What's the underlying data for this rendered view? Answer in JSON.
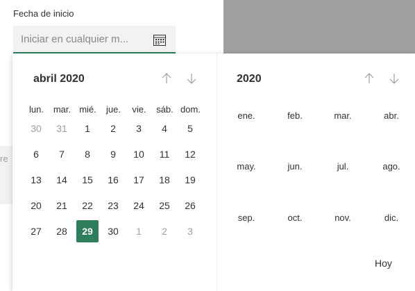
{
  "field": {
    "label": "Fecha de inicio",
    "placeholder": "Iniciar en cualquier m...",
    "icon": "calendar-icon"
  },
  "background": {
    "partial_text": "re"
  },
  "calendar": {
    "month_title": "abril 2020",
    "weekdays": [
      "lun.",
      "mar.",
      "mié.",
      "jue.",
      "vie.",
      "sáb.",
      "dom."
    ],
    "weeks": [
      [
        {
          "d": "30",
          "out": true
        },
        {
          "d": "31",
          "out": true
        },
        {
          "d": "1"
        },
        {
          "d": "2"
        },
        {
          "d": "3"
        },
        {
          "d": "4"
        },
        {
          "d": "5"
        }
      ],
      [
        {
          "d": "6"
        },
        {
          "d": "7"
        },
        {
          "d": "8"
        },
        {
          "d": "9"
        },
        {
          "d": "10"
        },
        {
          "d": "11"
        },
        {
          "d": "12"
        }
      ],
      [
        {
          "d": "13"
        },
        {
          "d": "14"
        },
        {
          "d": "15"
        },
        {
          "d": "16"
        },
        {
          "d": "17"
        },
        {
          "d": "18"
        },
        {
          "d": "19"
        }
      ],
      [
        {
          "d": "20"
        },
        {
          "d": "21"
        },
        {
          "d": "22"
        },
        {
          "d": "23"
        },
        {
          "d": "24"
        },
        {
          "d": "25"
        },
        {
          "d": "26"
        }
      ],
      [
        {
          "d": "27"
        },
        {
          "d": "28"
        },
        {
          "d": "29",
          "selected": true
        },
        {
          "d": "30"
        },
        {
          "d": "1",
          "out": true
        },
        {
          "d": "2",
          "out": true
        },
        {
          "d": "3",
          "out": true
        }
      ]
    ],
    "prev_icon": "arrow-up-icon",
    "next_icon": "arrow-down-icon"
  },
  "year_picker": {
    "year_title": "2020",
    "months": [
      "ene.",
      "feb.",
      "mar.",
      "abr.",
      "may.",
      "jun.",
      "jul.",
      "ago.",
      "sep.",
      "oct.",
      "nov.",
      "dic."
    ],
    "today_label": "Hoy"
  },
  "colors": {
    "accent": "#2e7d5b",
    "muted_text": "#a19f9d",
    "overlay_gray": "#a19f9d"
  }
}
